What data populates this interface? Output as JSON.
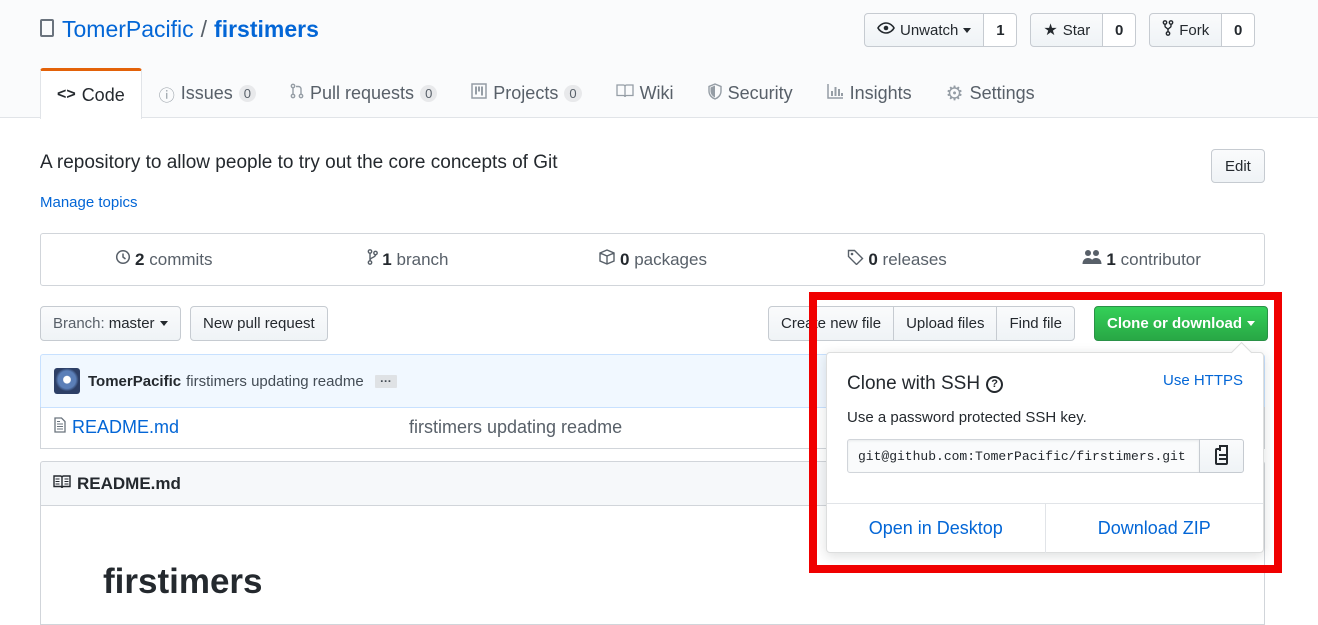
{
  "repo": {
    "owner": "TomerPacific",
    "separator": "/",
    "name": "firstimers"
  },
  "actions": {
    "watch_label": "Unwatch",
    "watch_count": "1",
    "star_label": "Star",
    "star_count": "0",
    "fork_label": "Fork",
    "fork_count": "0"
  },
  "nav": {
    "code": "Code",
    "issues": "Issues",
    "issues_count": "0",
    "pulls": "Pull requests",
    "pulls_count": "0",
    "projects": "Projects",
    "projects_count": "0",
    "wiki": "Wiki",
    "security": "Security",
    "insights": "Insights",
    "settings": "Settings"
  },
  "description": "A repository to allow people to try out the core concepts of Git",
  "manage_topics": "Manage topics",
  "edit_label": "Edit",
  "summary": {
    "commits_num": "2",
    "commits_label": "commits",
    "branches_num": "1",
    "branches_label": "branch",
    "packages_num": "0",
    "packages_label": "packages",
    "releases_num": "0",
    "releases_label": "releases",
    "contributors_num": "1",
    "contributors_label": "contributor"
  },
  "file_nav": {
    "branch_prefix": "Branch:",
    "branch_name": "master",
    "new_pr": "New pull request",
    "create_file": "Create new file",
    "upload_files": "Upload files",
    "find_file": "Find file",
    "clone": "Clone or download"
  },
  "commit": {
    "author": "TomerPacific",
    "message": "firstimers updating readme",
    "ellipsis": "…"
  },
  "files": [
    {
      "name": "README.md",
      "message": "firstimers updating readme"
    }
  ],
  "readme": {
    "filename": "README.md",
    "heading": "firstimers"
  },
  "clone_dropdown": {
    "title": "Clone with SSH",
    "help": "?",
    "use_https": "Use HTTPS",
    "subtitle": "Use a password protected SSH key.",
    "url": "git@github.com:TomerPacific/firstimers.git",
    "open_desktop": "Open in Desktop",
    "download_zip": "Download ZIP"
  },
  "colors": {
    "highlight": "#f00000",
    "link": "#0366d6",
    "primary_button": "#28a745",
    "selected_tab": "#e36209"
  },
  "icons": [
    "repo-icon",
    "eye-icon",
    "star-icon",
    "fork-icon",
    "code-icon",
    "issue-icon",
    "pull-request-icon",
    "project-icon",
    "book-icon",
    "shield-icon",
    "graph-icon",
    "gear-icon",
    "history-icon",
    "branch-icon",
    "package-icon",
    "tag-icon",
    "people-icon",
    "file-icon",
    "clippy-icon",
    "question-icon"
  ]
}
